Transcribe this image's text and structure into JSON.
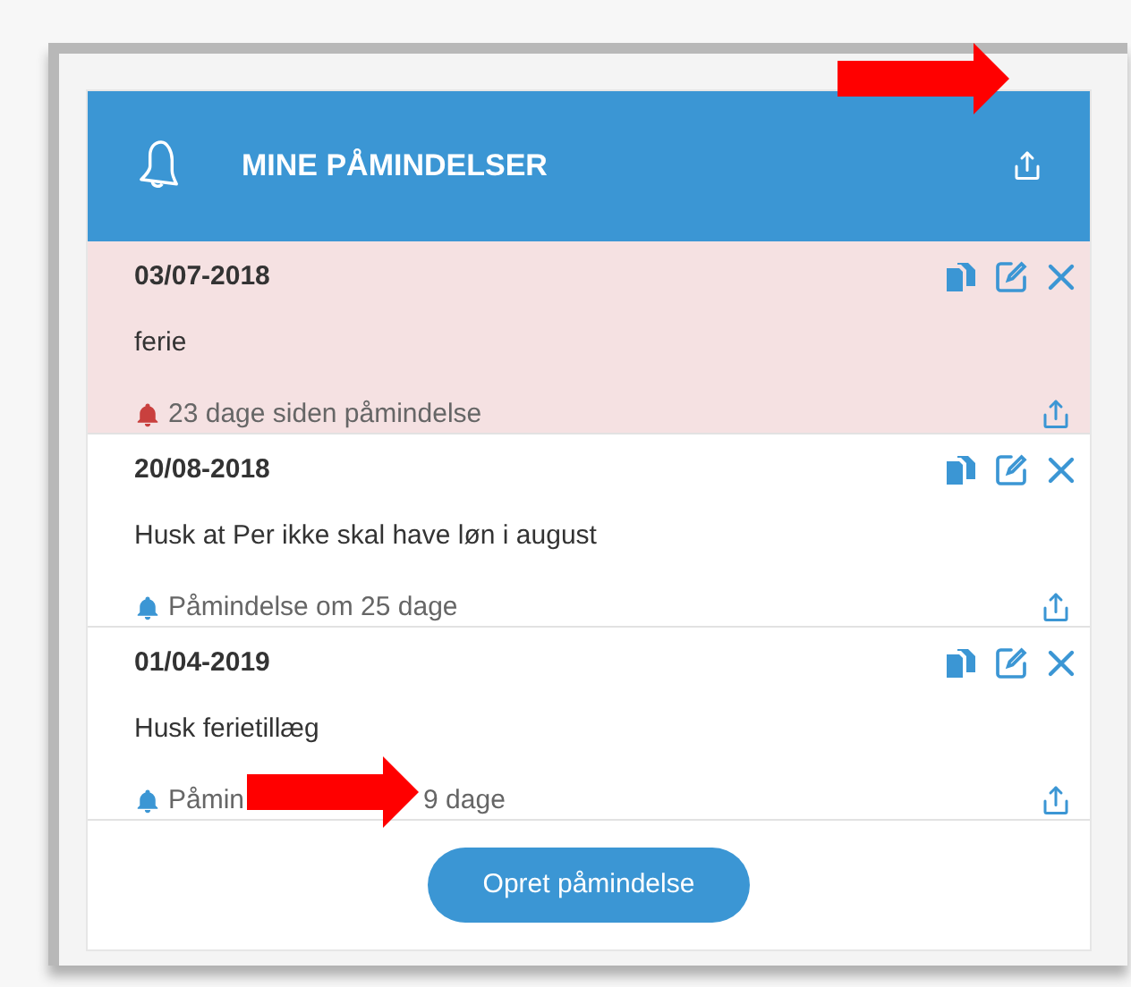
{
  "header": {
    "title": "MINE PÅMINDELSER"
  },
  "reminders": [
    {
      "date": "03/07-2018",
      "text": "ferie",
      "overdue": true,
      "status": "23 dage siden påmindelse"
    },
    {
      "date": "20/08-2018",
      "text": "Husk at Per ikke skal have løn i august",
      "overdue": false,
      "status": "Påmindelse om 25 dage"
    },
    {
      "date": "01/04-2019",
      "text": "Husk ferietillæg",
      "overdue": false,
      "status": "Påmin",
      "status_tail": "9 dage"
    }
  ],
  "button": "Opret påmindelse"
}
